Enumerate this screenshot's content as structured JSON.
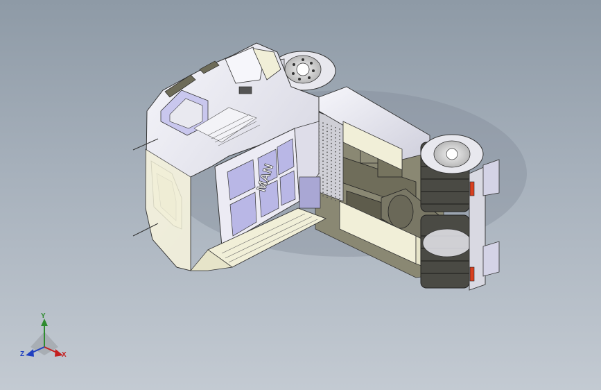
{
  "viewport": {
    "background_top": "#8e9aa6",
    "background_bottom": "#c3cad2"
  },
  "model": {
    "logo_text": "MAN",
    "body_color": "#e9e9f0",
    "cream_color": "#f1efd8",
    "panel_color": "#b9b7e6",
    "chassis_color": "#7f7d6a",
    "tire_color": "#4a4a44",
    "lamp_color": "#d8401f"
  },
  "triad": {
    "x_label": "X",
    "y_label": "Y",
    "z_label": "Z",
    "x_color": "#c42020",
    "y_color": "#2e8b2e",
    "z_color": "#2040c0"
  }
}
